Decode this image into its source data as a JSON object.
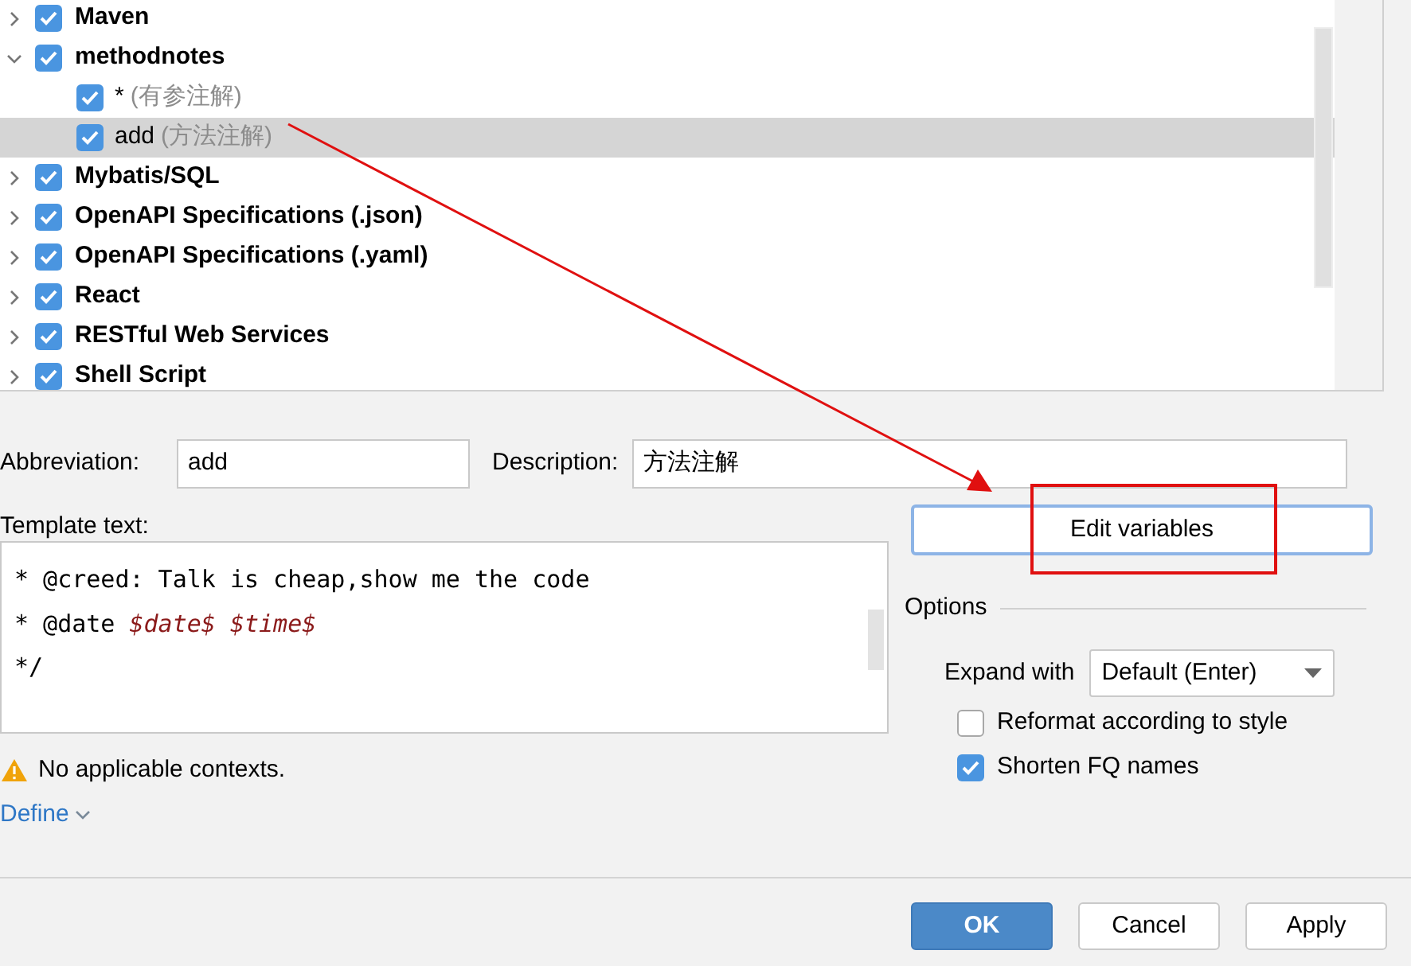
{
  "tree": [
    {
      "label": "Maven",
      "checked": true,
      "expanded": false
    },
    {
      "label": "methodnotes",
      "checked": true,
      "expanded": true,
      "children": [
        {
          "label": "*",
          "hint": "(有参注解)",
          "checked": true,
          "selected": false
        },
        {
          "label": "add",
          "hint": "(方法注解)",
          "checked": true,
          "selected": true
        }
      ]
    },
    {
      "label": "Mybatis/SQL",
      "checked": true,
      "expanded": false
    },
    {
      "label": "OpenAPI Specifications (.json)",
      "checked": true,
      "expanded": false
    },
    {
      "label": "OpenAPI Specifications (.yaml)",
      "checked": true,
      "expanded": false
    },
    {
      "label": "React",
      "checked": true,
      "expanded": false
    },
    {
      "label": "RESTful Web Services",
      "checked": true,
      "expanded": false
    },
    {
      "label": "Shell Script",
      "checked": true,
      "expanded": false
    }
  ],
  "abbreviation": {
    "label": "Abbreviation:",
    "value": "add"
  },
  "description": {
    "label": "Description:",
    "value": "方法注解"
  },
  "template": {
    "label": "Template text:",
    "lines": [
      [
        {
          "kind": "text",
          "text": "* @creed: Talk is cheap,show me the code"
        }
      ],
      [
        {
          "kind": "text",
          "text": "* @date "
        },
        {
          "kind": "var",
          "text": "$date$ $time$"
        }
      ],
      [
        {
          "kind": "text",
          "text": "*/"
        }
      ]
    ]
  },
  "warning": "No applicable contexts.",
  "define_link": "Define",
  "edit_variables_button": "Edit variables",
  "options": {
    "title": "Options",
    "expand_with_label": "Expand with",
    "expand_with_value": "Default (Enter)",
    "checkboxes": [
      {
        "label": "Reformat according to style",
        "checked": false
      },
      {
        "label": "Shorten FQ names",
        "checked": true
      }
    ]
  },
  "buttons": [
    {
      "label": "OK",
      "kind": "primary"
    },
    {
      "label": "Cancel",
      "kind": "normal"
    },
    {
      "label": "Apply",
      "kind": "normal"
    }
  ]
}
